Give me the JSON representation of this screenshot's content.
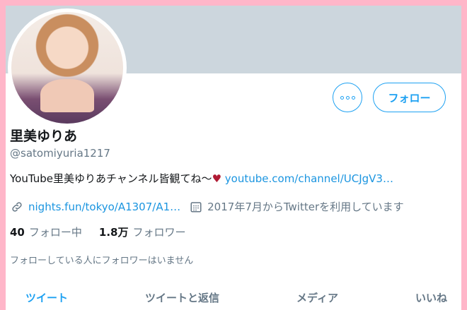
{
  "profile": {
    "name": "里美ゆりあ",
    "handle": "@satomiyuria1217",
    "bio_text": "YouTube里美ゆりあチャンネル皆観てね〜",
    "bio_heart": "♥",
    "bio_link": "youtube.com/channel/UCJgV3…",
    "website": "nights.fun/tokyo/A1307/A1…",
    "joined": "2017年7月からTwitterを利用しています",
    "following_count": "40",
    "following_label": "フォロー中",
    "followers_count": "1.8万",
    "followers_label": "フォロワー",
    "mutual_note": "フォローしている人にフォロワーはいません"
  },
  "buttons": {
    "follow": "フォロー"
  },
  "tabs": [
    {
      "label": "ツイート",
      "active": true
    },
    {
      "label": "ツイートと返信",
      "active": false
    },
    {
      "label": "メディア",
      "active": false
    },
    {
      "label": "いいね",
      "active": false
    }
  ],
  "colors": {
    "accent": "#1da1f2",
    "link": "#1b95e0",
    "banner": "#ccd6dd",
    "frame": "#ffb6c9",
    "heart": "#b01b34"
  },
  "icons": {
    "website": "link-icon",
    "joined": "calendar-icon",
    "more": "more-dots-icon"
  }
}
